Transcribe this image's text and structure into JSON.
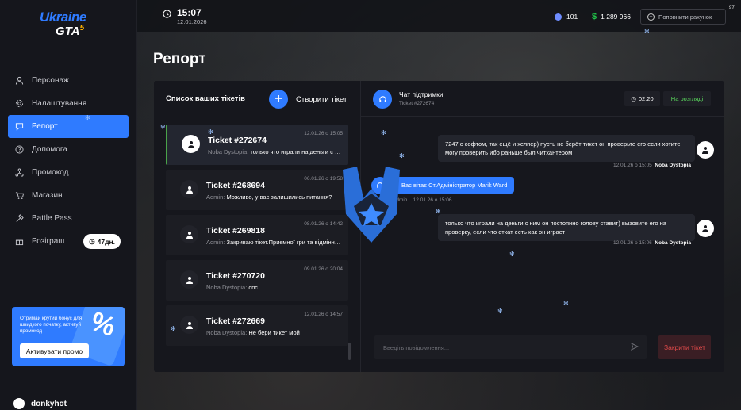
{
  "fps": "97",
  "brand": {
    "logo_line1": "Ukraine",
    "logo_line2": "GTA",
    "logo_sup": "5"
  },
  "sidebar": {
    "items": [
      {
        "label": "Персонаж",
        "icon": "person-icon"
      },
      {
        "label": "Налаштування",
        "icon": "gear-icon"
      },
      {
        "label": "Репорт",
        "icon": "chat-icon",
        "active": true
      },
      {
        "label": "Допомога",
        "icon": "help-icon"
      },
      {
        "label": "Промокод",
        "icon": "network-icon"
      },
      {
        "label": "Магазин",
        "icon": "cart-icon"
      },
      {
        "label": "Battle Pass",
        "icon": "hammer-icon"
      },
      {
        "label": "Розіграш",
        "icon": "gift-icon"
      }
    ],
    "giveaway_timer": "47дн."
  },
  "promo": {
    "text": "Отримай крутий бонус для швидкого початку, активуй промокод",
    "button": "Активувати промо",
    "ticket_symbol": "%"
  },
  "user": {
    "name": "donkyhot"
  },
  "topbar": {
    "time": "15:07",
    "date": "12.01.2026",
    "coins": "101",
    "money": "1 289 966",
    "money_symbol": "$",
    "topup": "Поповнити рахунок"
  },
  "page": {
    "title": "Репорт"
  },
  "tickets": {
    "header": "Список ваших тікетів",
    "create_label": "Створити тікет",
    "items": [
      {
        "name": "Ticket #272674",
        "date": "12.01.26 о 15:05",
        "author": "Noba Dystopia:",
        "text": "только что играли на деньги с ним он постоянно",
        "active": true
      },
      {
        "name": "Ticket #268694",
        "date": "06.01.26 о 19:58",
        "author": "Admin:",
        "text": "Можливо, у вас залишились питання?"
      },
      {
        "name": "Ticket #269818",
        "date": "08.01.26 о 14:42",
        "author": "Admin:",
        "text": "Закриваю тікет.Приємної гри та відмінного"
      },
      {
        "name": "Ticket #270720",
        "date": "09.01.26 о 20:04",
        "author": "Noba Dystopia:",
        "text": "спс"
      },
      {
        "name": "Ticket #272669",
        "date": "12.01.26 о 14:57",
        "author": "Noba Dystopia:",
        "text": "Не бери тикет мой"
      }
    ]
  },
  "chat": {
    "title": "Чат підтримки",
    "subtitle": "Ticket #272674",
    "timer": "02:20",
    "status": "На розгляді",
    "messages": [
      {
        "text": "7247 с софтом, так ещё и хелпер) пусть не берёт тикет он проверьте его если хотите могу проверить ибо раньше был читхантером",
        "time": "12.01.26 о 15:05",
        "author": "Noba Dystopia"
      },
      {
        "text": "Вас вітає Ст.Адміністратор Marik Ward",
        "author": "Admin",
        "time": "12.01.26 о 15:06"
      },
      {
        "text": "только что играли на деньги с ним он постоянно голову ставит) вызовите его на проверку, если что откат есть как он играет",
        "time": "12.01.26 о 15:06",
        "author": "Noba Dystopia"
      }
    ],
    "input_placeholder": "Введіть повідомлення...",
    "close_button": "Закрити тікет"
  }
}
